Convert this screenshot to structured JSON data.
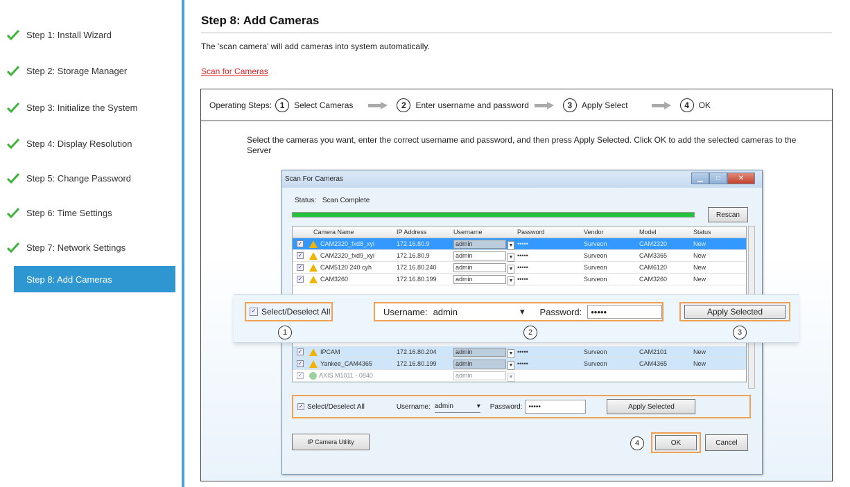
{
  "sidebar": {
    "steps": [
      {
        "label": "Step 1: Install Wizard"
      },
      {
        "label": "Step 2: Storage Manager"
      },
      {
        "label": "Step 3: Initialize the System"
      },
      {
        "label": "Step 4: Display Resolution"
      },
      {
        "label": "Step 5: Change Password"
      },
      {
        "label": "Step 6: Time Settings"
      },
      {
        "label": "Step 7: Network Settings"
      }
    ],
    "active_step": "Step 8: Add Cameras",
    "check_color": "#3fb23a",
    "active_color": "#2e96d0"
  },
  "main": {
    "title": "Step 8:  Add Cameras",
    "intro": "The 'scan camera' will add cameras into system automatically.",
    "scan_link": "Scan for Cameras",
    "operating_steps": {
      "label": "Operating Steps:",
      "steps": [
        {
          "num": "1",
          "text": "Select Cameras"
        },
        {
          "num": "2",
          "text": "Enter username and password"
        },
        {
          "num": "3",
          "text": "Apply Select"
        },
        {
          "num": "4",
          "text": "OK"
        }
      ]
    },
    "instructions": "Select the cameras you want, enter the correct username and password, and then press Apply Selected. Click OK to add the selected cameras to the Server"
  },
  "dialog": {
    "title": "Scan For Cameras",
    "status_label": "Status:",
    "status_value": "Scan Complete",
    "progress_fraction": 1.0,
    "rescan_label": "Rescan",
    "columns": [
      "Camera Name",
      "IP Address",
      "Username",
      "Password",
      "Vendor",
      "Model",
      "Status"
    ],
    "rows_top": [
      {
        "name": "CAM2320_fxd8_xyi",
        "ip": "172.16.80.9",
        "user": "admin",
        "pass": "•••••",
        "vendor": "Surveon",
        "model": "CAM2320",
        "status": "New"
      },
      {
        "name": "CAM2320_fxd9_xyi",
        "ip": "172.16.80.9",
        "user": "admin",
        "pass": "•••••",
        "vendor": "Surveon",
        "model": "CAM3365",
        "status": "New"
      },
      {
        "name": "CAM5120 240 cyh",
        "ip": "172.16.80.240",
        "user": "admin",
        "pass": "•••••",
        "vendor": "Surveon",
        "model": "CAM6120",
        "status": "New"
      },
      {
        "name": "CAM3260",
        "ip": "172.16.80.199",
        "user": "admin",
        "pass": "•••••",
        "vendor": "Surveon",
        "model": "CAM3260",
        "status": "New"
      }
    ],
    "rows_bottom": [
      {
        "name": "IPCAM",
        "ip": "172.16.80.204",
        "user": "admin",
        "pass": "•••••",
        "vendor": "Surveon",
        "model": "CAM2101",
        "status": "New"
      },
      {
        "name": "Yankee_CAM4365",
        "ip": "172.16.80.199",
        "user": "admin",
        "pass": "•••••",
        "vendor": "Surveon",
        "model": "CAM4365",
        "status": "New"
      },
      {
        "name": "AXIS M1011 - 0840",
        "ip": "",
        "user": "admin",
        "pass": "",
        "vendor": "",
        "model": "",
        "status": ""
      }
    ],
    "select_all_label": "Select/Deselect All",
    "username_label": "Username:",
    "username_value": "admin",
    "password_label": "Password:",
    "password_value": "•••••",
    "apply_label": "Apply Selected",
    "ipcam_utility_label": "IP Camera Utility",
    "ok_label": "OK",
    "cancel_label": "Cancel"
  },
  "callout": {
    "select_all_label": "Select/Deselect All",
    "username_label": "Username:",
    "username_value": "admin",
    "password_label": "Password:",
    "password_value": "•••••",
    "apply_label": "Apply Selected",
    "badges": [
      "1",
      "2",
      "3",
      "4"
    ]
  }
}
